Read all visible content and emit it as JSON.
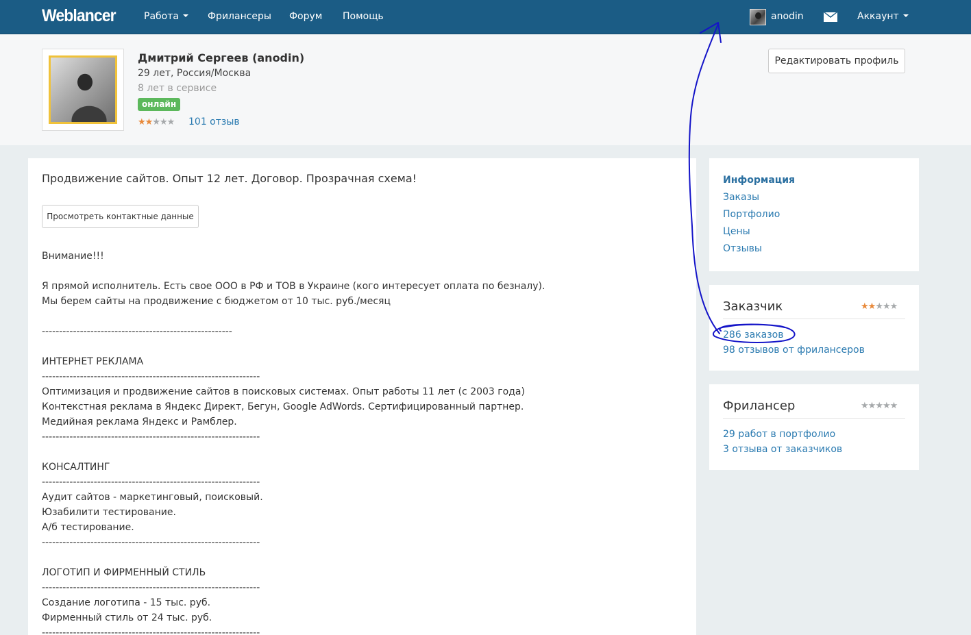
{
  "navbar": {
    "logo": "Weblancer",
    "items": [
      {
        "label": "Работа",
        "has_caret": true
      },
      {
        "label": "Фрилансеры"
      },
      {
        "label": "Форум"
      },
      {
        "label": "Помощь"
      }
    ],
    "username": "anodin",
    "account_label": "Аккаунт",
    "icons": {
      "avatar": "user-avatar",
      "mail": "envelope-icon"
    }
  },
  "profile": {
    "name": "Дмитрий Сергеев (anodin)",
    "location": "29 лет, Россия/Москва",
    "service": "8 лет в сервисе",
    "status": "онлайн",
    "rating": {
      "value": 2,
      "max": 5
    },
    "reviews": "101 отзыв",
    "edit_button": "Редактировать профиль"
  },
  "main": {
    "tagline": "Продвижение сайтов. Опыт 12 лет. Договор. Прозрачная схема!",
    "contacts_button": "Просмотреть контактные данные",
    "description": "Внимание!!!\n\nЯ прямой исполнитель. Есть свое ООО в РФ и ТОВ в Украине (кого интересует оплата по безналу).\nМы берем сайты на продвижение с бюджетом от 10 тыс. руб./месяц\n\n-------------------------------------------------------\n\nИНТЕРНЕТ РЕКЛАМА\n---------------------------------------------------------------\nОптимизация и продвижение сайтов в поисковых системах. Опыт работы 11 лет (с 2003 года)\nКонтекстная реклама в Яндекс Директ, Бегун, Google AdWords. Сертифицированный партнер.\nМедийная реклама Яндекс и Рамблер.\n---------------------------------------------------------------\n\nКОНСАЛТИНГ\n---------------------------------------------------------------\nАудит сайтов - маркетинговый, поисковый.\nЮзабилити тестирование.\nА/б тестирование.\n---------------------------------------------------------------\n\nЛОГОТИП И ФИРМЕННЫЙ СТИЛЬ\n---------------------------------------------------------------\nСоздание логотипа - 15 тыс. руб.\nФирменный стиль от 24 тыс. руб.\n---------------------------------------------------------------"
  },
  "sidebar": {
    "nav": [
      {
        "label": "Информация",
        "active": true
      },
      {
        "label": "Заказы"
      },
      {
        "label": "Портфолио"
      },
      {
        "label": "Цены"
      },
      {
        "label": "Отзывы"
      }
    ],
    "customer": {
      "title": "Заказчик",
      "rating": {
        "value": 2,
        "max": 5
      },
      "orders": "286 заказов",
      "reviews": "98 отзывов от фрилансеров"
    },
    "freelancer": {
      "title": "Фрилансер",
      "rating": {
        "value": 0,
        "max": 5
      },
      "portfolio": "29 работ в портфолио",
      "reviews": "3 отзыва от заказчиков"
    }
  },
  "colors": {
    "navbar": "#1b5c85",
    "link": "#2a7ab0",
    "star_active": "#e8893a",
    "star_inactive": "#a6a9ab",
    "online": "#5cb85c",
    "annotation": "#1414c8"
  }
}
